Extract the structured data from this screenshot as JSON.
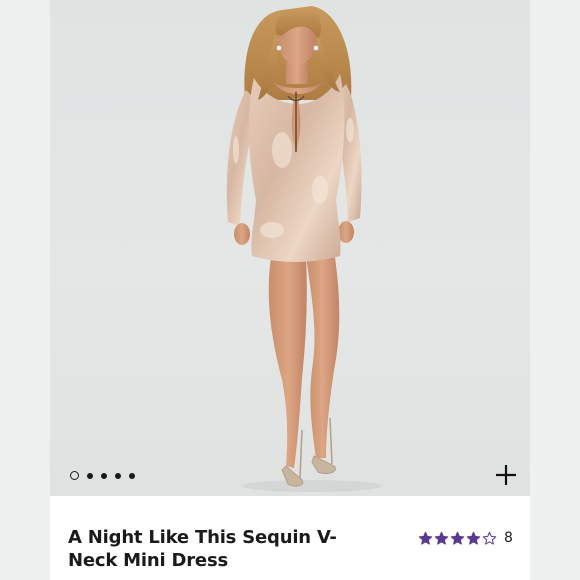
{
  "product": {
    "title": "A Night Like This Sequin V-Neck Mini Dress",
    "rating": 4,
    "rating_max": 5,
    "review_count": "8",
    "star_color": "#5b3a91"
  },
  "gallery": {
    "image_alt": "Model wearing a nude sequin long-sleeve mini dress with keyhole neckline and clear strappy heels",
    "slide_count": 5,
    "active_index": 0,
    "add_icon": "plus-icon"
  },
  "colors": {
    "background": "#eceeed",
    "card": "#ffffff",
    "dress": "#d9bca8",
    "text": "#1b1b1b"
  }
}
